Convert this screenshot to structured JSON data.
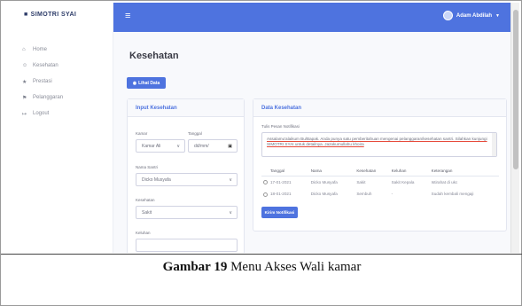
{
  "brand": {
    "name": "SIMOTRI SYAI"
  },
  "sidebar": {
    "items": [
      {
        "label": "Home",
        "icon": "home-icon"
      },
      {
        "label": "Kesehatan",
        "icon": "user-icon"
      },
      {
        "label": "Prestasi",
        "icon": "trophy-icon"
      },
      {
        "label": "Pelanggaran",
        "icon": "users-icon"
      },
      {
        "label": "Logout",
        "icon": "logout-icon"
      }
    ]
  },
  "topbar": {
    "user_name": "Adam Abdilah",
    "color": "#4e73df"
  },
  "main": {
    "title": "Kesehatan",
    "lihat_button": "Lihat Data"
  },
  "input_card": {
    "title": "Input Kesehatan",
    "kamar_label": "Kamar",
    "kamar_value": "Kamar Ali",
    "tanggal_label": "Tanggal",
    "tanggal_value": "dd/mm/",
    "nama_label": "Nama Santri",
    "nama_value": "Dicko Musyafa",
    "kesehatan_label": "Kesehatan",
    "kesehatan_value": "Sakit",
    "keluhan_label": "Keluhan"
  },
  "data_card": {
    "title": "Data Kesehatan",
    "pesan_label": "Tulis Pesan Notifikasi",
    "pesan_text": "Assalamu'alaikum Bu/Bapak. Anda punya satu pemberitahuan mengenai pelanggaran/kesehatan santri. Silahkan kunjungi SIMOTRI SYAI untuk detailnya. Jazakumullahu khoira",
    "columns": [
      "Tanggal",
      "Nama",
      "Kesehatan",
      "Keluhan",
      "Keterangan"
    ],
    "rows": [
      [
        "17-01-2021",
        "Dicko Musyafa",
        "Sakit",
        "Sakit Kepala",
        "Istirahat di ukc"
      ],
      [
        "18-01-2021",
        "Dicko Musyafa",
        "Sembuh",
        "-",
        "Sudah kembali mengaji"
      ]
    ],
    "kirim_button": "Kirim Notifikasi"
  },
  "caption": {
    "bold": "Gambar 19",
    "rest": " Menu Akses Wali kamar"
  }
}
